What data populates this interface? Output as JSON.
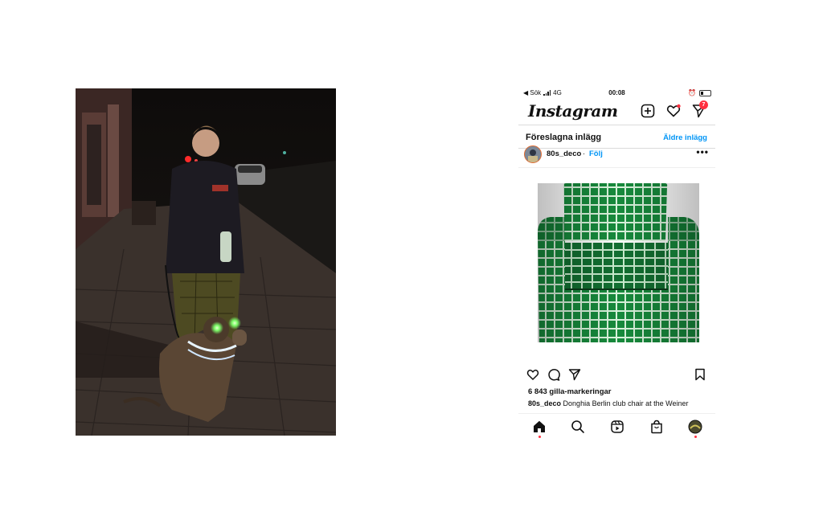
{
  "left_photo": {
    "description_icon": "photo-person-with-dog-night"
  },
  "instagram": {
    "status_bar": {
      "back_label": "◀ Sök",
      "network": "4G",
      "time": "00:08"
    },
    "header": {
      "logo": "Instagram",
      "notification_badge": "7",
      "icons": [
        "add-post-icon",
        "heart-icon",
        "send-icon"
      ]
    },
    "suggested": {
      "title": "Föreslagna inlägg",
      "older_posts": "Äldre inlägg"
    },
    "post": {
      "username": "80s_deco",
      "separator": "·",
      "follow": "Följ",
      "more": "•••",
      "likes": "6 843 gilla-markeringar",
      "caption_user": "80s_deco",
      "caption_text": "Donghia Berlin club chair at the Weiner"
    },
    "tabbar": {
      "items": [
        "home-icon",
        "search-icon",
        "reels-icon",
        "shop-icon",
        "profile-avatar"
      ]
    },
    "colors": {
      "accent": "#0095f6",
      "badge": "#ff3040",
      "chair_green": "#1e9a45"
    }
  }
}
